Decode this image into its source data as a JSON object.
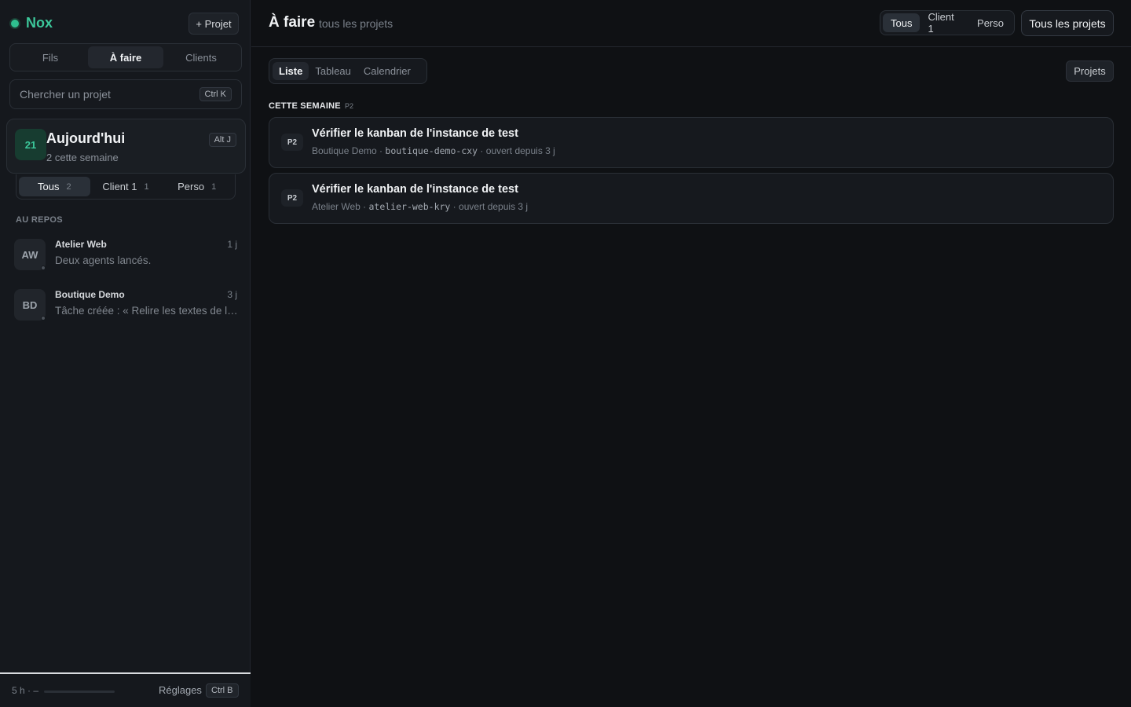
{
  "brand": {
    "name": "Nox",
    "color": "#3cc79a"
  },
  "sidebar": {
    "new_project_label": "+ Projet",
    "tabs": [
      {
        "label": "Fils",
        "active": false
      },
      {
        "label": "À faire",
        "active": true
      },
      {
        "label": "Clients",
        "active": false
      }
    ],
    "search": {
      "placeholder": "Chercher un projet",
      "shortcut": "Ctrl K"
    },
    "today": {
      "date": "21",
      "title": "Aujourd'hui",
      "subtitle": "2 cette semaine",
      "shortcut": "Alt J"
    },
    "filters": [
      {
        "label": "Tous",
        "count": "2",
        "active": true
      },
      {
        "label": "Client 1",
        "count": "1",
        "active": false
      },
      {
        "label": "Perso",
        "count": "1",
        "active": false
      }
    ],
    "idle_section_label": "AU REPOS",
    "projects": [
      {
        "initials": "AW",
        "name": "Atelier Web",
        "message": "Deux agents lancés.",
        "time": "1 j"
      },
      {
        "initials": "BD",
        "name": "Boutique Demo",
        "message": "Tâche créée : « Relire les textes de la page d'accueil »",
        "time": "3 j"
      }
    ],
    "footer": {
      "usage": "5 h · –",
      "settings_label": "Réglages",
      "settings_shortcut": "Ctrl B"
    }
  },
  "main": {
    "title": "À faire",
    "subtitle": "tous les projets",
    "scope_tabs": [
      {
        "label": "Tous",
        "active": true
      },
      {
        "label": "Client 1",
        "active": false
      },
      {
        "label": "Perso",
        "active": false
      }
    ],
    "all_projects_label": "Tous les projets",
    "view_tabs": [
      {
        "label": "Liste",
        "active": true
      },
      {
        "label": "Tableau",
        "active": false
      },
      {
        "label": "Calendrier",
        "active": false
      }
    ],
    "projects_button_label": "Projets",
    "section": {
      "label": "CETTE SEMAINE",
      "badge": "P2"
    },
    "tasks": [
      {
        "priority": "P2",
        "title": "Vérifier le kanban de l'instance de test",
        "project": "Boutique Demo",
        "slug": "boutique-demo-cxy",
        "age": "ouvert depuis 3 j"
      },
      {
        "priority": "P2",
        "title": "Vérifier le kanban de l'instance de test",
        "project": "Atelier Web",
        "slug": "atelier-web-kry",
        "age": "ouvert depuis 3 j"
      }
    ]
  },
  "colors": {
    "background": "#0f1114",
    "sidebar": "#15181d",
    "accent": "#3cc79a",
    "border": "#2a2f36"
  }
}
